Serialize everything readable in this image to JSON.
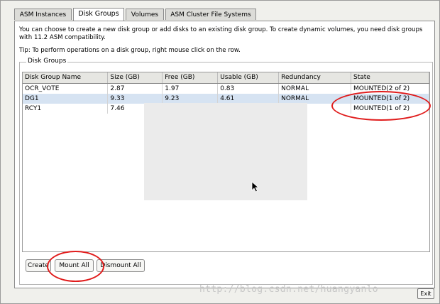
{
  "tabs": [
    "ASM Instances",
    "Disk Groups",
    "Volumes",
    "ASM Cluster File Systems"
  ],
  "intro_text": "You can choose to create a new disk group or add disks to an existing disk group. To create dynamic volumes, you need disk groups with 11.2 ASM compatibility.",
  "tip_text": "Tip: To perform operations on a disk group, right mouse click on the row.",
  "group_label": "Disk Groups",
  "table": {
    "columns": [
      "Disk Group Name",
      "Size (GB)",
      "Free (GB)",
      "Usable (GB)",
      "Redundancy",
      "State"
    ],
    "rows": [
      [
        "OCR_VOTE",
        "2.87",
        "1.97",
        "0.83",
        "NORMAL",
        "MOUNTED(2 of 2)"
      ],
      [
        "DG1",
        "9.33",
        "9.23",
        "4.61",
        "NORMAL",
        "MOUNTED(1 of 2)"
      ],
      [
        "RCY1",
        "7.46",
        "",
        "",
        "",
        "MOUNTED(1 of 2)"
      ]
    ]
  },
  "buttons": {
    "create": "Create",
    "mount_all": "Mount All",
    "dismount_all": "Dismount All",
    "exit": "Exit"
  },
  "watermark": "http://blog.csdn.net/huangyanlo",
  "colors": {
    "annotation": "#e01c1c",
    "selected_row": "#d6e3f2"
  }
}
